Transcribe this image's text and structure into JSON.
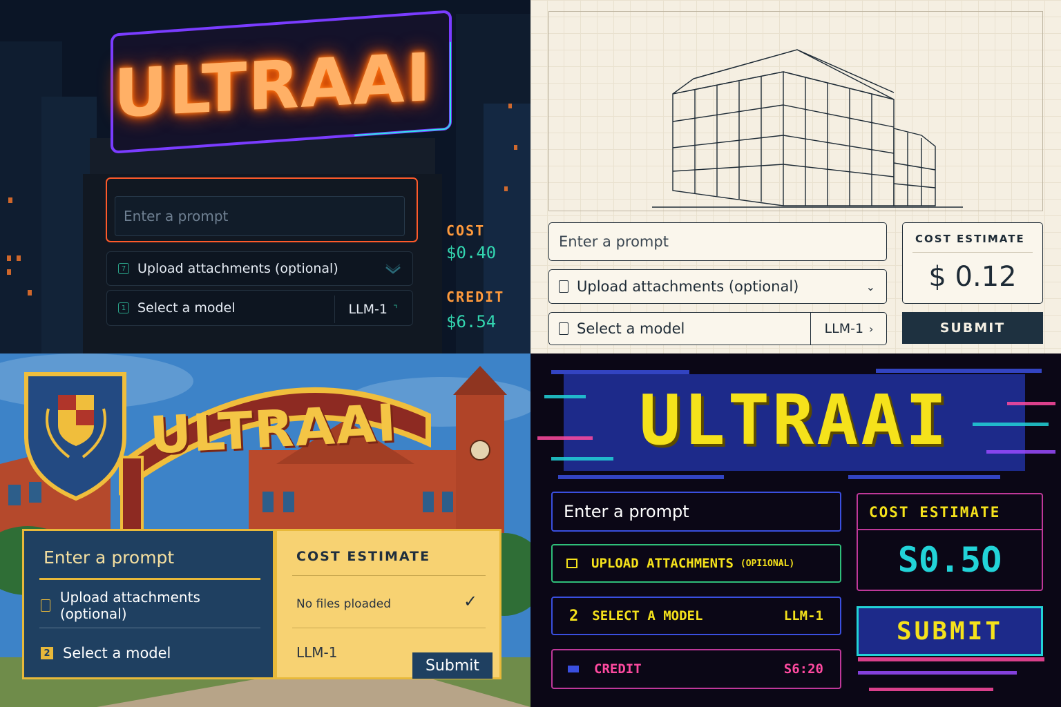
{
  "q1": {
    "title": "ULTRAAI",
    "prompt_placeholder": "Enter a prompt",
    "upload_label": "Upload attachments (optional)",
    "model_label": "Select a model",
    "model_value": "LLM-1",
    "cost_label": "COST",
    "cost_value": "$0.40",
    "credit_label": "CREDIT",
    "credit_value": "$6.54"
  },
  "q2": {
    "prompt_placeholder": "Enter a prompt",
    "upload_label": "Upload attachments (optional)",
    "model_label": "Select a model",
    "model_value": "LLM-1",
    "cost_label": "COST ESTIMATE",
    "cost_value": "$ 0.12",
    "submit_label": "SUBMIT"
  },
  "q3": {
    "title": "ULTRAAI",
    "prompt_placeholder": "Enter a prompt",
    "upload_label": "Upload attachments (optional)",
    "model_label": "Select a model",
    "model_step": "2",
    "cost_label": "COST ESTIMATE",
    "files_status": "No files ploaded",
    "model_value": "LLM-1",
    "submit_label": "Submit"
  },
  "q4": {
    "title": "ULTRAAI",
    "prompt_placeholder": "Enter a prompt",
    "upload_label": "UPLOAD ATTACHMENTS",
    "upload_optional": "(OPI1ONAL)",
    "model_step": "2",
    "model_label": "SELECT A MODEL",
    "model_value": "LLM-1",
    "credit_label": "CREDIT",
    "credit_value": "S6:20",
    "cost_label": "COST ESTIMATE",
    "cost_value": "S0.5O",
    "submit_label": "SUBMIT"
  },
  "colors": {
    "neon_orange": "#ff9a3c",
    "neon_teal": "#33d6b0",
    "blueprint_ink": "#1e2b36",
    "campus_gold": "#f4c545",
    "campus_navy": "#1f4061",
    "pixel_yellow": "#f5e21b",
    "pixel_cyan": "#22d3d8"
  },
  "icons": [
    "attachment-icon",
    "model-icon",
    "chevron-down-icon",
    "chevron-right-icon",
    "checkmark-icon",
    "credit-icon"
  ]
}
